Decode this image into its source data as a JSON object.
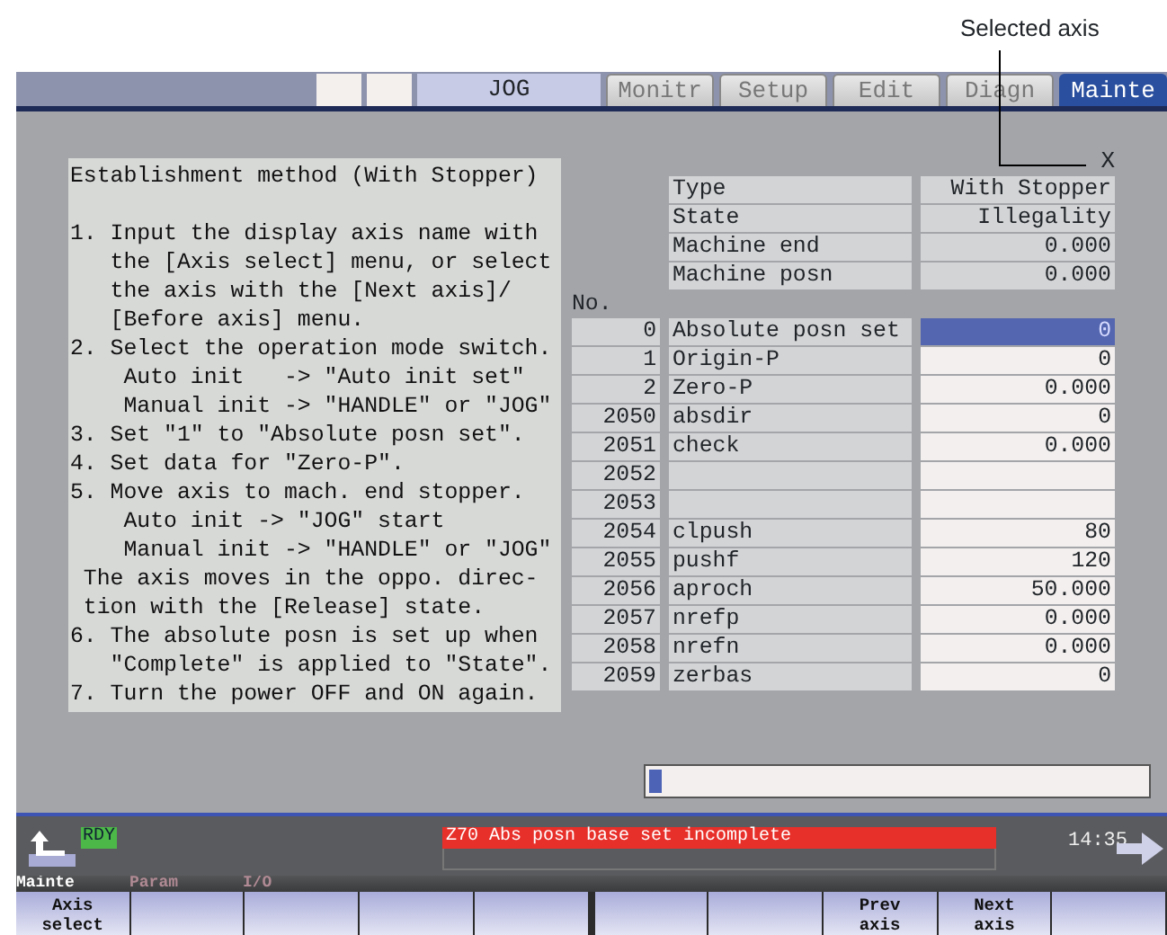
{
  "annotation": {
    "label": "Selected axis"
  },
  "header": {
    "mode": "JOG",
    "tabs": [
      {
        "label": "Monitr",
        "selected": false
      },
      {
        "label": "Setup",
        "selected": false
      },
      {
        "label": "Edit",
        "selected": false
      },
      {
        "label": "Diagn",
        "selected": false
      },
      {
        "label": "Mainte",
        "selected": true
      }
    ]
  },
  "axis": "X",
  "guide": {
    "title": "Establishment method (With Stopper)",
    "lines": [
      {
        "kind": "step",
        "text": "1. Input the display axis name with"
      },
      {
        "kind": "cont",
        "text": "the [Axis select] menu, or select"
      },
      {
        "kind": "cont",
        "text": "the axis with the [Next axis]/"
      },
      {
        "kind": "cont",
        "text": "[Before axis] menu."
      },
      {
        "kind": "step",
        "text": "2. Select the operation mode switch."
      },
      {
        "kind": "sub",
        "text": "Auto init   -> \"Auto init set\""
      },
      {
        "kind": "sub",
        "text": "Manual init -> \"HANDLE\" or \"JOG\""
      },
      {
        "kind": "step",
        "text": "3. Set \"1\" to \"Absolute posn set\"."
      },
      {
        "kind": "step",
        "text": "4. Set data for \"Zero-P\"."
      },
      {
        "kind": "step",
        "text": "5. Move axis to mach. end stopper."
      },
      {
        "kind": "sub",
        "text": "Auto init -> \"JOG\" start"
      },
      {
        "kind": "sub",
        "text": "Manual init -> \"HANDLE\" or \"JOG\""
      },
      {
        "kind": "note",
        "text": "The axis moves in the oppo. direc-"
      },
      {
        "kind": "note",
        "text": "tion with the [Release] state."
      },
      {
        "kind": "step",
        "text": "6. The absolute posn is set up when"
      },
      {
        "kind": "cont",
        "text": "\"Complete\" is applied to \"State\"."
      },
      {
        "kind": "step",
        "text": "7. Turn the power OFF and ON again."
      }
    ]
  },
  "info": [
    {
      "label": "Type",
      "value": "With Stopper"
    },
    {
      "label": "State",
      "value": "Illegality"
    },
    {
      "label": "Machine end",
      "value": "0.000"
    },
    {
      "label": "Machine posn",
      "value": "0.000"
    }
  ],
  "no_heading": "No.",
  "params": [
    {
      "no": "0",
      "name": "Absolute posn set",
      "value": "0",
      "selected": true
    },
    {
      "no": "1",
      "name": "Origin-P",
      "value": "0",
      "selected": false
    },
    {
      "no": "2",
      "name": "Zero-P",
      "value": "0.000",
      "selected": false
    },
    {
      "no": "2050",
      "name": "absdir",
      "value": "0",
      "selected": false
    },
    {
      "no": "2051",
      "name": "check",
      "value": "0.000",
      "selected": false
    },
    {
      "no": "2052",
      "selected": false
    },
    {
      "no": "2053",
      "selected": false
    },
    {
      "no": "2054",
      "name": "clpush",
      "value": "80",
      "selected": false
    },
    {
      "no": "2055",
      "name": "pushf",
      "value": "120",
      "selected": false
    },
    {
      "no": "2056",
      "name": "aproch",
      "value": "50.000",
      "selected": false
    },
    {
      "no": "2057",
      "name": "nrefp",
      "value": "0.000",
      "selected": false
    },
    {
      "no": "2058",
      "name": "nrefn",
      "value": "0.000",
      "selected": false
    },
    {
      "no": "2059",
      "name": "zerbas",
      "value": "0",
      "selected": false
    }
  ],
  "status": {
    "ready": "RDY",
    "alarm": "Z70  Abs posn base set incomplete",
    "time": "14:35"
  },
  "menu": [
    {
      "label": "Mainte",
      "selected": true
    },
    {
      "label": "Param",
      "selected": false
    },
    {
      "label": "I/O",
      "selected": false
    }
  ],
  "softkeys": [
    {
      "kind": "key",
      "label": "Axis\nselect"
    },
    {
      "kind": "blank"
    },
    {
      "kind": "blank"
    },
    {
      "kind": "blank"
    },
    {
      "kind": "blank"
    },
    {
      "kind": "blank"
    },
    {
      "kind": "blank"
    },
    {
      "kind": "key",
      "label": "Prev\naxis"
    },
    {
      "kind": "key",
      "label": "Next\naxis"
    },
    {
      "kind": "blank"
    }
  ]
}
